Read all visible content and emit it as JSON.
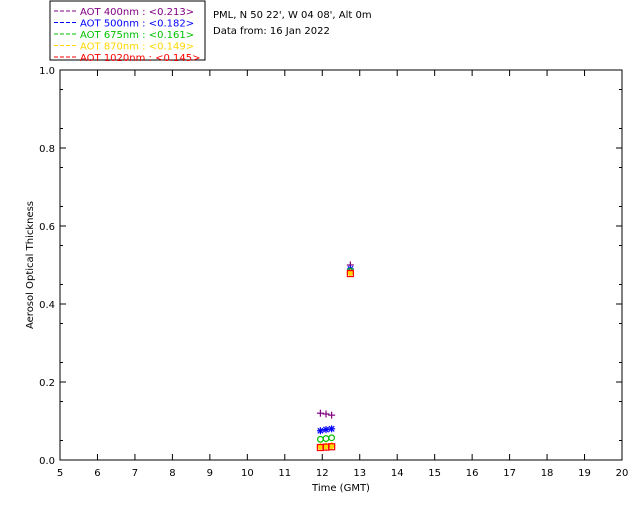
{
  "header": {
    "station": "PML, N 50 22', W 04 08', Alt 0m",
    "date": "Data from: 16 Jan 2022"
  },
  "chart_data": {
    "type": "scatter",
    "xlabel": "Time (GMT)",
    "ylabel": "Aerosol Optical Thickness",
    "xlim": [
      5,
      20
    ],
    "ylim": [
      0,
      1.0
    ],
    "x_ticks": [
      "5",
      "6",
      "7",
      "8",
      "9",
      "10",
      "11",
      "12",
      "13",
      "14",
      "15",
      "16",
      "17",
      "18",
      "19",
      "20"
    ],
    "y_ticks": [
      "0.0",
      "0.2",
      "0.4",
      "0.6",
      "0.8",
      "1.0"
    ],
    "grid": false,
    "legend_position": "top-left",
    "series": [
      {
        "name": "AOT  400nm : <0.213>",
        "color": "#800080",
        "marker": "plus",
        "x": [
          11.95,
          12.1,
          12.25,
          12.75
        ],
        "y": [
          0.12,
          0.118,
          0.115,
          0.5
        ]
      },
      {
        "name": "AOT  500nm : <0.182>",
        "color": "#0000ff",
        "marker": "asterisk",
        "x": [
          11.95,
          12.1,
          12.25,
          12.75
        ],
        "y": [
          0.075,
          0.078,
          0.08,
          0.49
        ]
      },
      {
        "name": "AOT  675nm : <0.161>",
        "color": "#00c000",
        "marker": "circle",
        "x": [
          11.95,
          12.1,
          12.25,
          12.75
        ],
        "y": [
          0.053,
          0.055,
          0.057,
          0.485
        ]
      },
      {
        "name": "AOT  870nm : <0.149>",
        "color": "#ffd700",
        "marker": "diamond",
        "x": [
          11.95,
          12.1,
          12.25,
          12.75
        ],
        "y": [
          0.034,
          0.035,
          0.036,
          0.48
        ]
      },
      {
        "name": "AOT 1020nm : <0.145>",
        "color": "#ff0000",
        "marker": "square",
        "x": [
          11.95,
          12.1,
          12.25,
          12.75
        ],
        "y": [
          0.032,
          0.033,
          0.034,
          0.478
        ]
      }
    ]
  }
}
